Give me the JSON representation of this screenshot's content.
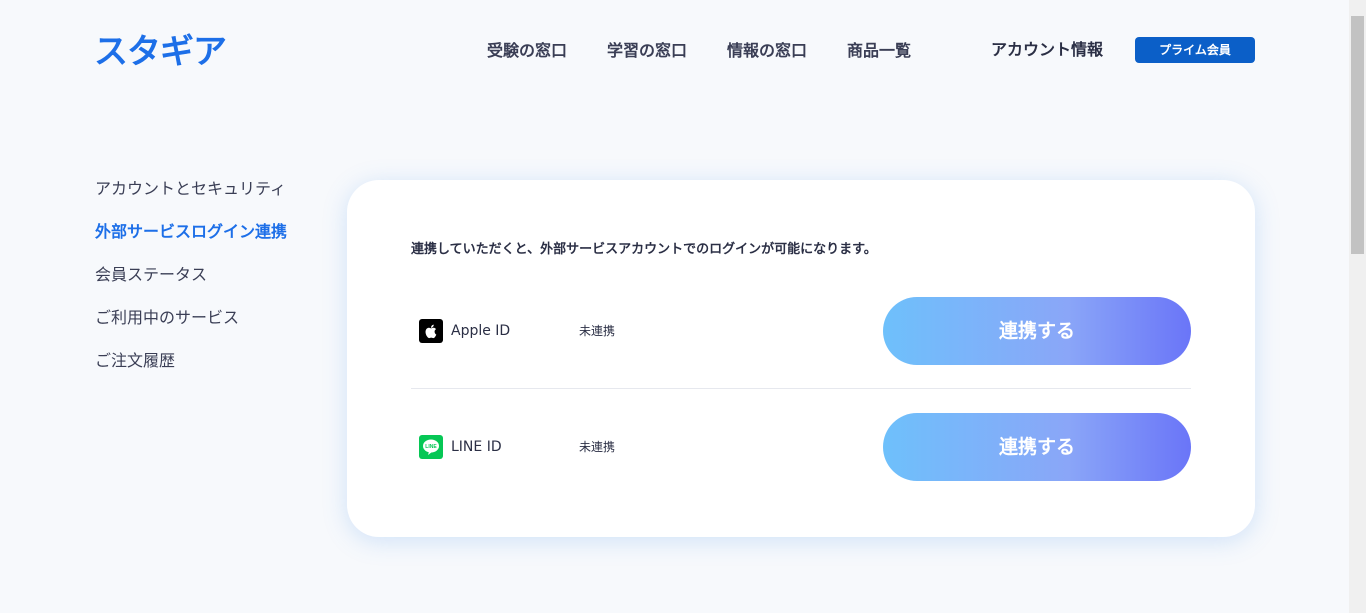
{
  "header": {
    "logo": "スタギア",
    "nav": [
      "受験の窓口",
      "学習の窓口",
      "情報の窓口",
      "商品一覧"
    ],
    "account_label": "アカウント情報",
    "prime_label": "プライム会員"
  },
  "sidebar": {
    "items": [
      {
        "label": "アカウントとセキュリティ",
        "active": false
      },
      {
        "label": "外部サービスログイン連携",
        "active": true
      },
      {
        "label": "会員ステータス",
        "active": false
      },
      {
        "label": "ご利用中のサービス",
        "active": false
      },
      {
        "label": "ご注文履歴",
        "active": false
      }
    ]
  },
  "main": {
    "intro": "連携していただくと、外部サービスアカウントでのログインが可能になります。",
    "services": [
      {
        "name": "Apple ID",
        "status": "未連携",
        "button": "連携する",
        "icon": "apple-icon"
      },
      {
        "name": "LINE ID",
        "status": "未連携",
        "button": "連携する",
        "icon": "line-icon"
      }
    ]
  },
  "colors": {
    "brand": "#1d6fe8",
    "prime_button": "#0b5fc8",
    "line_green": "#06c755"
  }
}
